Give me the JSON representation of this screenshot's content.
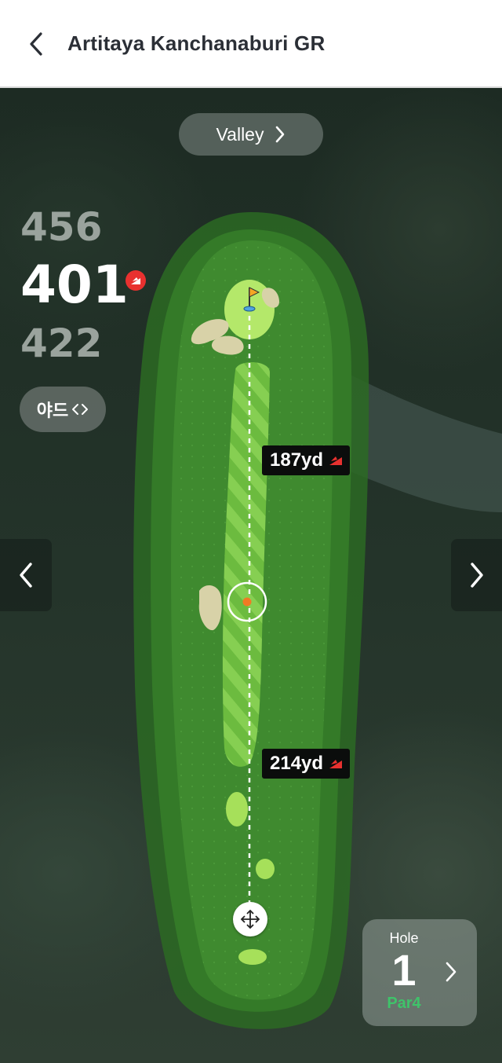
{
  "header": {
    "title": "Artitaya Kanchanaburi GR"
  },
  "course_selector": {
    "label": "Valley"
  },
  "distances": {
    "top": "456",
    "selected": "401",
    "bottom": "422"
  },
  "unit_toggle": {
    "label": "야드"
  },
  "markers": {
    "upper_distance": "187yd",
    "lower_distance": "214yd"
  },
  "hole": {
    "label": "Hole",
    "number": "1",
    "par": "Par4"
  },
  "colors": {
    "accent_red": "#e8312f",
    "fairway": "#3d8a2e",
    "rough": "#2e6b25",
    "green": "#a6e05a",
    "par_green": "#3fc36a"
  },
  "icons": {
    "back": "chevron-left-icon",
    "course_next": "chevron-right-icon",
    "prev_hole": "chevron-left-icon",
    "next_hole": "chevron-right-icon",
    "tee": "tee-flag-icon",
    "pin": "flag-icon",
    "move": "move-arrows-icon"
  }
}
